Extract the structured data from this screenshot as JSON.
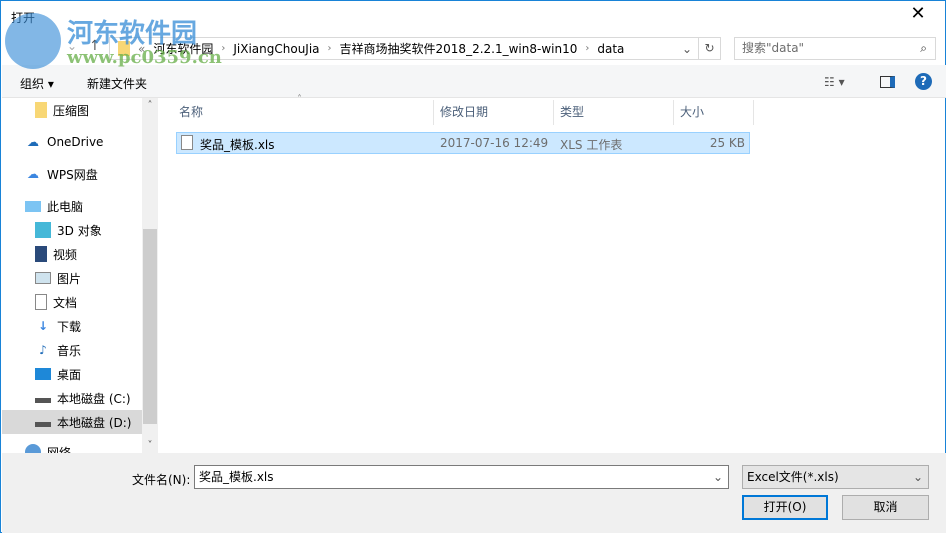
{
  "title": "打开",
  "address": {
    "crumbs": [
      "河东软件园",
      "JiXiangChouJia",
      "吉祥商场抽奖软件2018_2.2.1_win8-win10",
      "data"
    ],
    "prefix": "«"
  },
  "search": {
    "placeholder": "搜索\"data\""
  },
  "toolbar": {
    "organize": "组织 ▾",
    "new_folder": "新建文件夹"
  },
  "sidebar": {
    "items": [
      {
        "label": "压缩图",
        "icon": "folder-icon"
      },
      {
        "label": "OneDrive",
        "icon": "cloud-icon"
      },
      {
        "label": "WPS网盘",
        "icon": "cloud-outline-icon"
      },
      {
        "label": "此电脑",
        "icon": "computer-icon"
      },
      {
        "label": "3D 对象",
        "icon": "cube-icon"
      },
      {
        "label": "视频",
        "icon": "video-icon"
      },
      {
        "label": "图片",
        "icon": "picture-icon"
      },
      {
        "label": "文档",
        "icon": "document-icon"
      },
      {
        "label": "下载",
        "icon": "download-icon"
      },
      {
        "label": "音乐",
        "icon": "music-icon"
      },
      {
        "label": "桌面",
        "icon": "desktop-icon"
      },
      {
        "label": "本地磁盘 (C:)",
        "icon": "drive-icon"
      },
      {
        "label": "本地磁盘 (D:)",
        "icon": "drive-icon"
      },
      {
        "label": "网络",
        "icon": "network-icon"
      }
    ]
  },
  "columns": [
    "名称",
    "修改日期",
    "类型",
    "大小"
  ],
  "files": [
    {
      "name": "奖品_模板.xls",
      "modified": "2017-07-16 12:49",
      "type": "XLS 工作表",
      "size": "25 KB"
    }
  ],
  "bottom": {
    "filename_label": "文件名(N):",
    "filename_value": "奖品_模板.xls",
    "filter": "Excel文件(*.xls)",
    "open": "打开(O)",
    "cancel": "取消"
  },
  "watermark": {
    "name": "河东软件园",
    "url": "www.pc0359.cn"
  }
}
